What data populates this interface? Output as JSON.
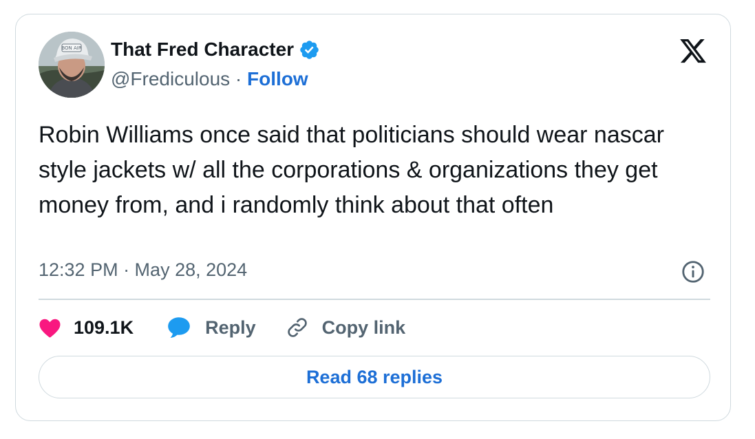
{
  "author": {
    "name": "That Fred Character",
    "handle": "@Frediculous",
    "separator": " · ",
    "follow_label": "Follow",
    "verified": true,
    "cap_text": "BON AIR"
  },
  "tweet": {
    "text": "Robin Williams once said that politicians should wear nascar style jackets w/ all the corporations & organizations they get money from, and i randomly think about that often",
    "timestamp": "12:32 PM · May 28, 2024"
  },
  "actions": {
    "likes_count": "109.1K",
    "reply_label": "Reply",
    "copy_link_label": "Copy link"
  },
  "read_replies_label": "Read 68 replies",
  "icons": {
    "logo": "x-logo-icon",
    "verified": "verified-badge-icon",
    "info": "info-icon",
    "like": "heart-icon",
    "reply": "speech-bubble-icon",
    "copy": "link-icon"
  },
  "colors": {
    "accent": "#1d6fd6",
    "verified": "#1d9bf0",
    "like": "#f91880",
    "reply": "#1d9bf0",
    "muted": "#536471",
    "border": "#cfd9de"
  }
}
